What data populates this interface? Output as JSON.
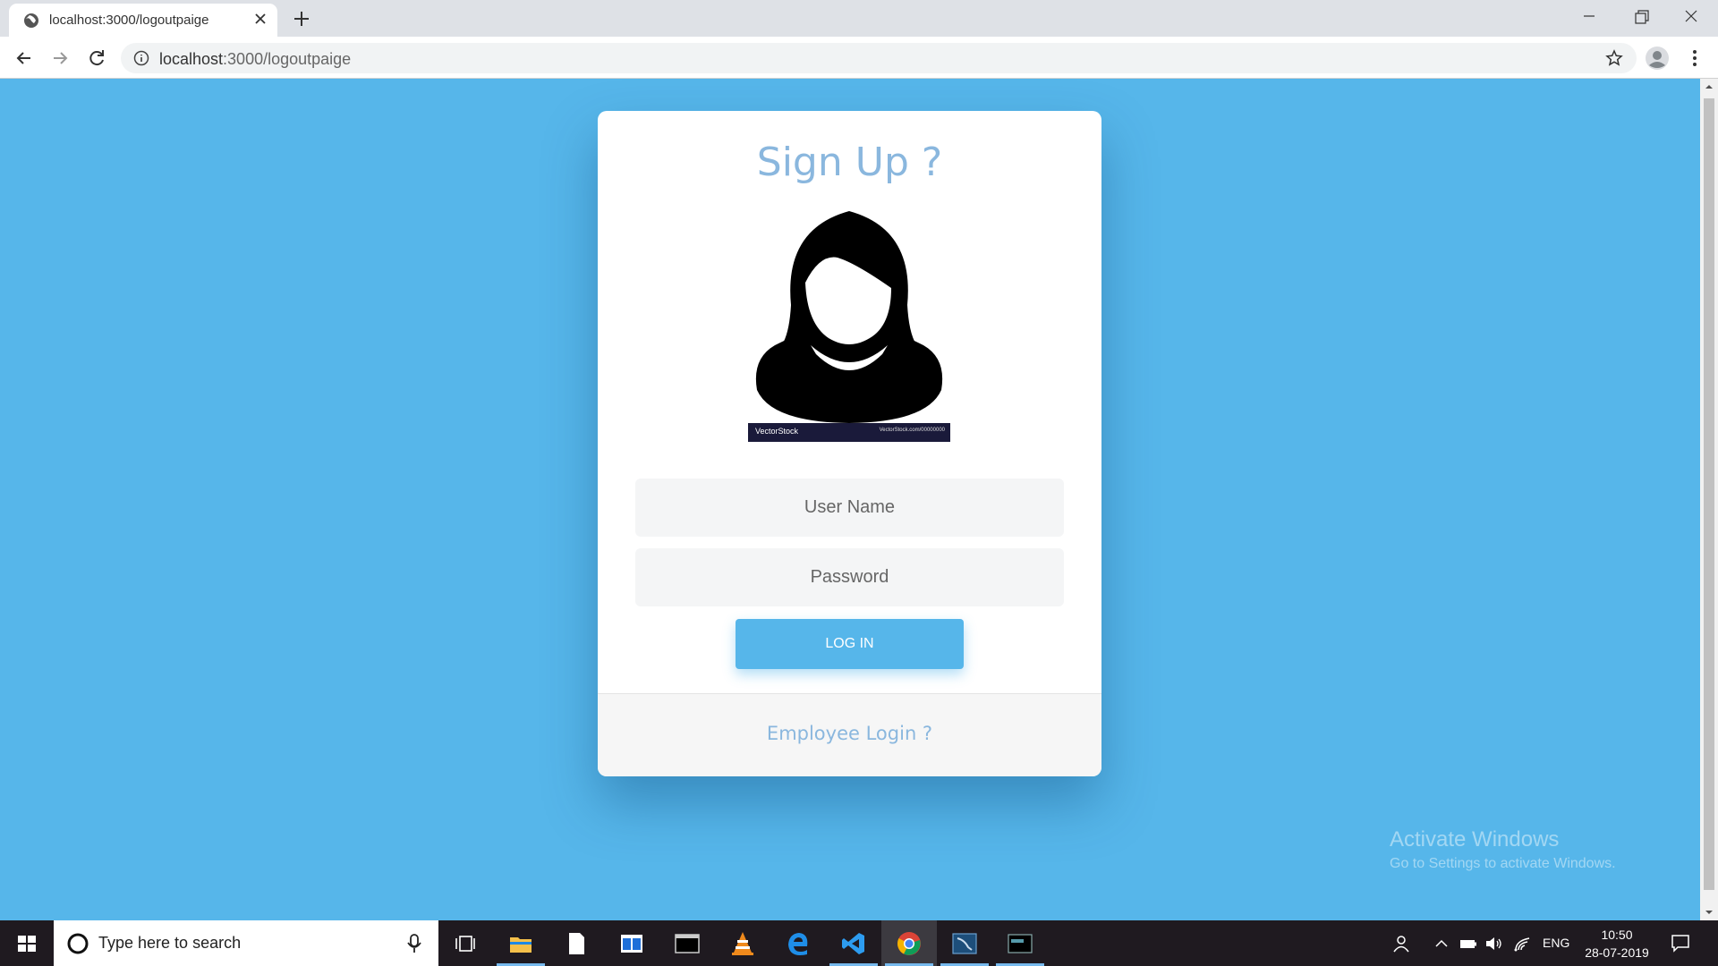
{
  "browser": {
    "tab_title": "localhost:3000/logoutpaige",
    "url_host": "localhost",
    "url_path": ":3000/logoutpaige"
  },
  "page": {
    "title": "Sign Up ?",
    "avatar_watermark_left": "VectorStock",
    "avatar_watermark_right": "VectorStock.com/00000000",
    "username_placeholder": "User Name",
    "password_placeholder": "Password",
    "login_button": "LOG IN",
    "footer_link": "Employee Login ?",
    "background_color": "#56b6ea",
    "accent_text_color": "#8ab7de"
  },
  "watermark": {
    "line1": "Activate Windows",
    "line2": "Go to Settings to activate Windows."
  },
  "taskbar": {
    "search_placeholder": "Type here to search",
    "language": "ENG",
    "time": "10:50",
    "date": "28-07-2019",
    "apps": [
      "task-view",
      "file-explorer",
      "notepad",
      "store-app",
      "terminal",
      "vlc",
      "edge",
      "vscode",
      "chrome",
      "mysql-workbench",
      "mysql-shell"
    ]
  }
}
